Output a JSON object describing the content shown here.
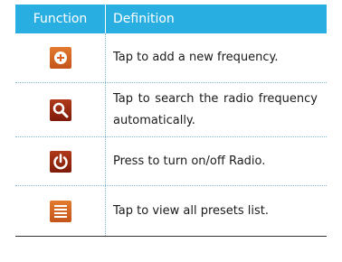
{
  "table": {
    "header": {
      "function_label": "Function",
      "definition_label": "Definition"
    },
    "rows": [
      {
        "icon": "add-frequency-icon",
        "definition": "Tap to add a new frequency."
      },
      {
        "icon": "search-icon",
        "definition": "Tap to search the radio frequency automatically."
      },
      {
        "icon": "power-icon",
        "definition": "Press to turn on/off Radio."
      },
      {
        "icon": "presets-list-icon",
        "definition": "Tap to view all presets list."
      }
    ]
  },
  "colors": {
    "header_bg": "#29aee2",
    "icon_orange": "#d96322",
    "icon_dark_red": "#9a2a12"
  }
}
